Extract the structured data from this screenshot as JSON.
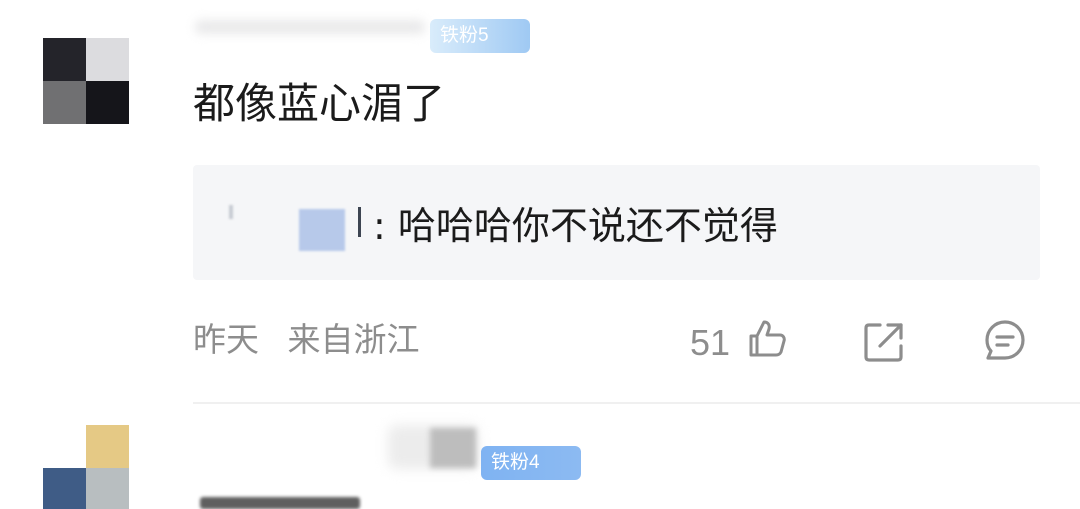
{
  "comments": [
    {
      "badge": "铁粉5",
      "text": "都像蓝心湄了",
      "reply": {
        "separator": ":",
        "text": "哈哈哈你不说还不觉得"
      },
      "time": "昨天",
      "location": "来自浙江",
      "likes": "51"
    },
    {
      "badge": "铁粉4"
    }
  ],
  "icons": {
    "like": "thumbs-up-icon",
    "share": "share-icon",
    "reply": "comment-bubble-icon"
  },
  "colors": {
    "text": "#1b1b1b",
    "meta": "#8d8d8d",
    "reply_bg": "#f5f6f8",
    "badge": "#9fc9f3"
  }
}
